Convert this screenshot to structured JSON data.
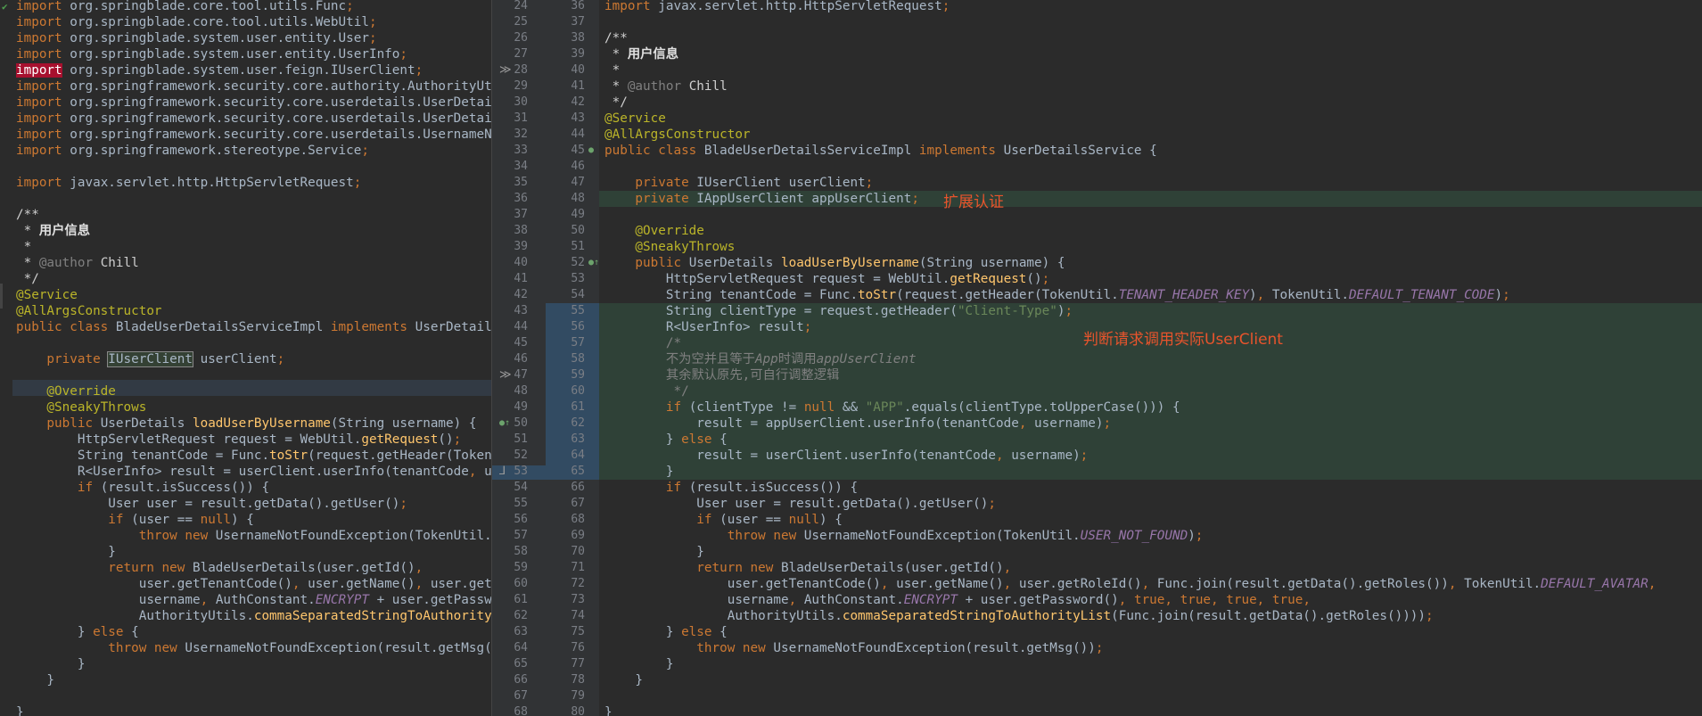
{
  "left_lines": [
    "import org.springblade.core.tool.utils.Func;",
    "import org.springblade.core.tool.utils.WebUtil;",
    "import org.springblade.system.user.entity.User;",
    "import org.springblade.system.user.entity.UserInfo;",
    "import org.springblade.system.user.feign.IUserClient;",
    "import org.springframework.security.core.authority.AuthorityUtils;",
    "import org.springframework.security.core.userdetails.UserDetails;",
    "import org.springframework.security.core.userdetails.UserDetailsService;",
    "import org.springframework.security.core.userdetails.UsernameNotFoundException;",
    "import org.springframework.stereotype.Service;",
    "",
    "import javax.servlet.http.HttpServletRequest;",
    "",
    "/**",
    " * 用户信息",
    " *",
    " * @author Chill",
    " */",
    "@Service",
    "@AllArgsConstructor",
    "public class BladeUserDetailsServiceImpl implements UserDetailsService {",
    "",
    "    private IUserClient userClient;",
    "",
    "    @Override",
    "    @SneakyThrows",
    "    public UserDetails loadUserByUsername(String username) {",
    "        HttpServletRequest request = WebUtil.getRequest();",
    "        String tenantCode = Func.toStr(request.getHeader(TokenUtil.TENANT_HEADER_KEY), TokenUtil.DEFAULT_TENANT_CODE);",
    "        R<UserInfo> result = userClient.userInfo(tenantCode, username);",
    "        if (result.isSuccess()) {",
    "            User user = result.getData().getUser();",
    "            if (user == null) {",
    "                throw new UsernameNotFoundException(TokenUtil.USER_NOT_FOUND);",
    "            }",
    "            return new BladeUserDetails(user.getId(),",
    "                user.getTenantCode(), user.getName(), user.getRoleId(),",
    "                username, AuthConstant.ENCRYPT + user.getPassword(),",
    "                AuthorityUtils.commaSeparatedStringToAuthorityList(",
    "        } else {",
    "            throw new UsernameNotFoundException(result.getMsg());",
    "            }",
    "    }",
    "",
    "}"
  ],
  "left_line_numbers": [
    "24",
    "25",
    "26",
    "27",
    "28",
    "29",
    "30",
    "31",
    "32",
    "33",
    "34",
    "35",
    "36",
    "37",
    "38",
    "39",
    "40",
    "41",
    "42",
    "43",
    "44",
    "45",
    "46",
    "47",
    "48",
    "49",
    "50",
    "51",
    "52",
    "53",
    "54",
    "55",
    "56",
    "57",
    "58",
    "59",
    "60",
    "61",
    "62",
    "63",
    "64",
    "65",
    "66",
    "67",
    "68"
  ],
  "right_line_numbers": [
    "36",
    "37",
    "38",
    "39",
    "40",
    "41",
    "42",
    "43",
    "44",
    "45",
    "46",
    "47",
    "48",
    "49",
    "50",
    "51",
    "52",
    "53",
    "54",
    "55",
    "56",
    "57",
    "58",
    "59",
    "60",
    "61",
    "62",
    "63",
    "64",
    "65",
    "66",
    "67",
    "68",
    "69",
    "70",
    "71",
    "72",
    "73",
    "74",
    "75",
    "76",
    "77",
    "78",
    "79",
    "80"
  ],
  "right_lines": [
    "import javax.servlet.http.HttpServletRequest;",
    "",
    "/**",
    " * 用户信息",
    " *",
    " * @author Chill",
    " */",
    "@Service",
    "@AllArgsConstructor",
    "public class BladeUserDetailsServiceImpl implements UserDetailsService {",
    "",
    "    private IUserClient userClient;",
    "    private IAppUserClient appUserClient;",
    "",
    "    @Override",
    "    @SneakyThrows",
    "    public UserDetails loadUserByUsername(String username) {",
    "        HttpServletRequest request = WebUtil.getRequest();",
    "        String tenantCode = Func.toStr(request.getHeader(TokenUtil.TENANT_HEADER_KEY), TokenUtil.DEFAULT_TENANT_CODE);",
    "        String clientType = request.getHeader(\"Client-Type\");",
    "        R<UserInfo> result;",
    "        /*",
    "        不为空并且等于App时调用appUserClient",
    "        其余默认原先,可自行调整逻辑",
    "         */",
    "        if (clientType != null && \"APP\".equals(clientType.toUpperCase())) {",
    "            result = appUserClient.userInfo(tenantCode, username);",
    "        } else {",
    "            result = userClient.userInfo(tenantCode, username);",
    "        }",
    "        if (result.isSuccess()) {",
    "            User user = result.getData().getUser();",
    "            if (user == null) {",
    "                throw new UsernameNotFoundException(TokenUtil.USER_NOT_FOUND);",
    "            }",
    "            return new BladeUserDetails(user.getId(),",
    "                user.getTenantCode(), user.getName(), user.getRoleId(), Func.join(result.getData().getRoles()), TokenUtil.DEFAULT_AVATAR,",
    "                username, AuthConstant.ENCRYPT + user.getPassword(), true, true, true, true,",
    "                AuthorityUtils.commaSeparatedStringToAuthorityList(Func.join(result.getData().getRoles())));",
    "        } else {",
    "            throw new UsernameNotFoundException(result.getMsg());",
    "        }",
    "    }",
    "",
    "}"
  ],
  "annotations": {
    "extend_auth": "扩展认证",
    "judge_request": "判断请求调用实际UserClient"
  },
  "gutter_markers": {
    "diff_arrow_1": "≫",
    "diff_arrow_2": "≫",
    "bind_marker": "⅃"
  },
  "colors": {
    "keyword": "#cc7832",
    "string": "#6a8759",
    "annotation": "#bbb529",
    "field": "#9876aa",
    "method": "#ffc66d",
    "added_highlight": "#2f4137",
    "changed_highlight": "#324b62",
    "annotation_text": "#e8542c"
  }
}
